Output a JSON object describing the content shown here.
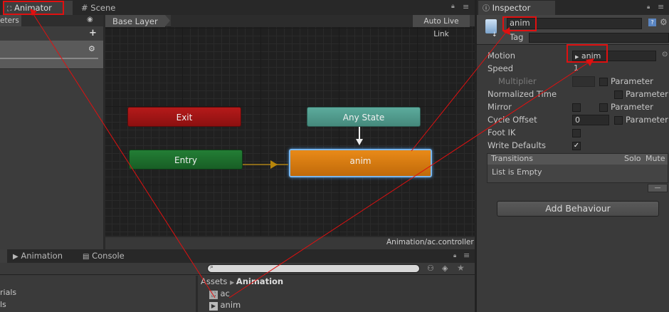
{
  "animator_window": {
    "tab_label": "Animator",
    "scene_tab_label": "Scene",
    "params_tab_label": "eters",
    "base_layer": "Base Layer",
    "auto_live_link": "Auto Live Link",
    "controller_path": "Animation/ac.controller",
    "nodes": {
      "exit": "Exit",
      "any_state": "Any State",
      "entry": "Entry",
      "anim": "anim"
    },
    "colors": {
      "exit": "#9a1212",
      "any_state": "#4e9a8c",
      "entry": "#1b6b2a",
      "anim": "#d4780f",
      "highlight_border": "#e01010"
    }
  },
  "inspector": {
    "tab_label": "Inspector",
    "state_name": "anim",
    "tag_label": "Tag",
    "properties": {
      "motion_label": "Motion",
      "motion_value": "anim",
      "speed_label": "Speed",
      "speed_value": "1",
      "multiplier_label": "Multiplier",
      "normalized_time_label": "Normalized Time",
      "mirror_label": "Mirror",
      "cycle_offset_label": "Cycle Offset",
      "cycle_offset_value": "0",
      "foot_ik_label": "Foot IK",
      "write_defaults_label": "Write Defaults",
      "parameter_label": "Parameter"
    },
    "transitions": {
      "header": "Transitions",
      "solo": "Solo",
      "mute": "Mute",
      "empty_text": "List is Empty",
      "remove_label": "—"
    },
    "add_behaviour_label": "Add Behaviour"
  },
  "bottom_panel": {
    "tabs": [
      "Animation",
      "Console"
    ],
    "breadcrumb_root": "Assets",
    "breadcrumb_folder": "Animation",
    "assets": [
      "ac",
      "anim"
    ],
    "left_items": [
      "rials",
      "ls"
    ]
  }
}
